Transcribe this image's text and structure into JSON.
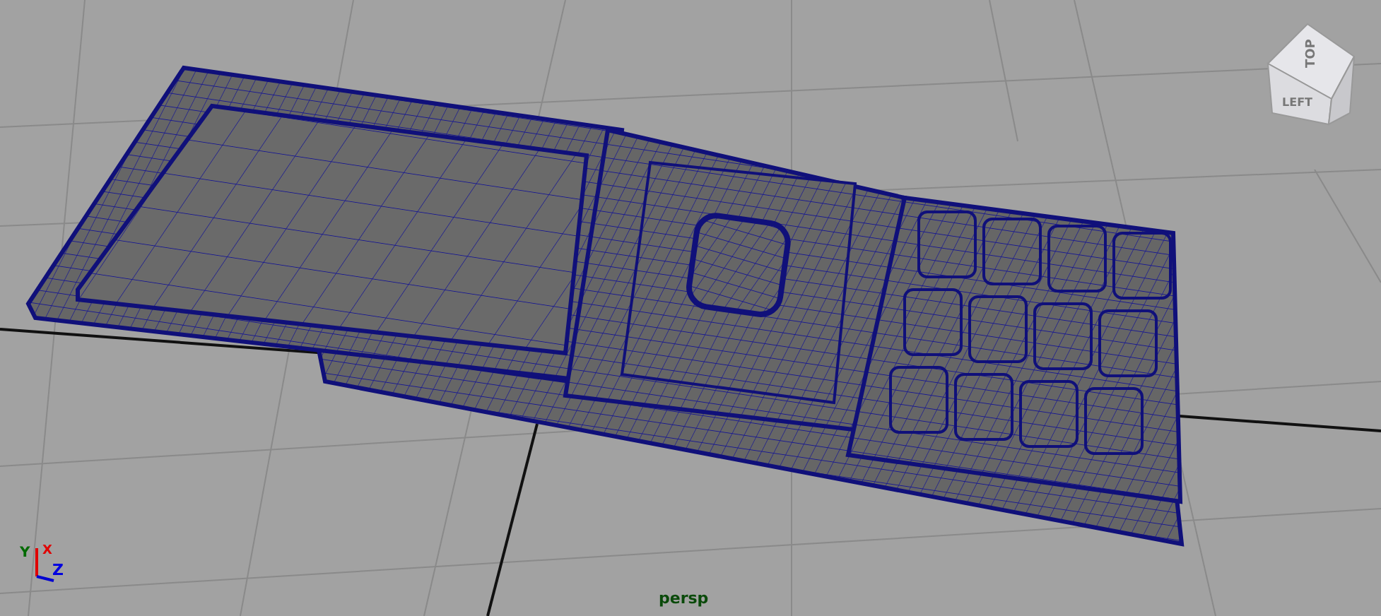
{
  "view_cube": {
    "top": "TOP",
    "left": "LEFT"
  },
  "axis": {
    "y": "Y",
    "x": "X",
    "z": "Z"
  },
  "camera": "persp"
}
